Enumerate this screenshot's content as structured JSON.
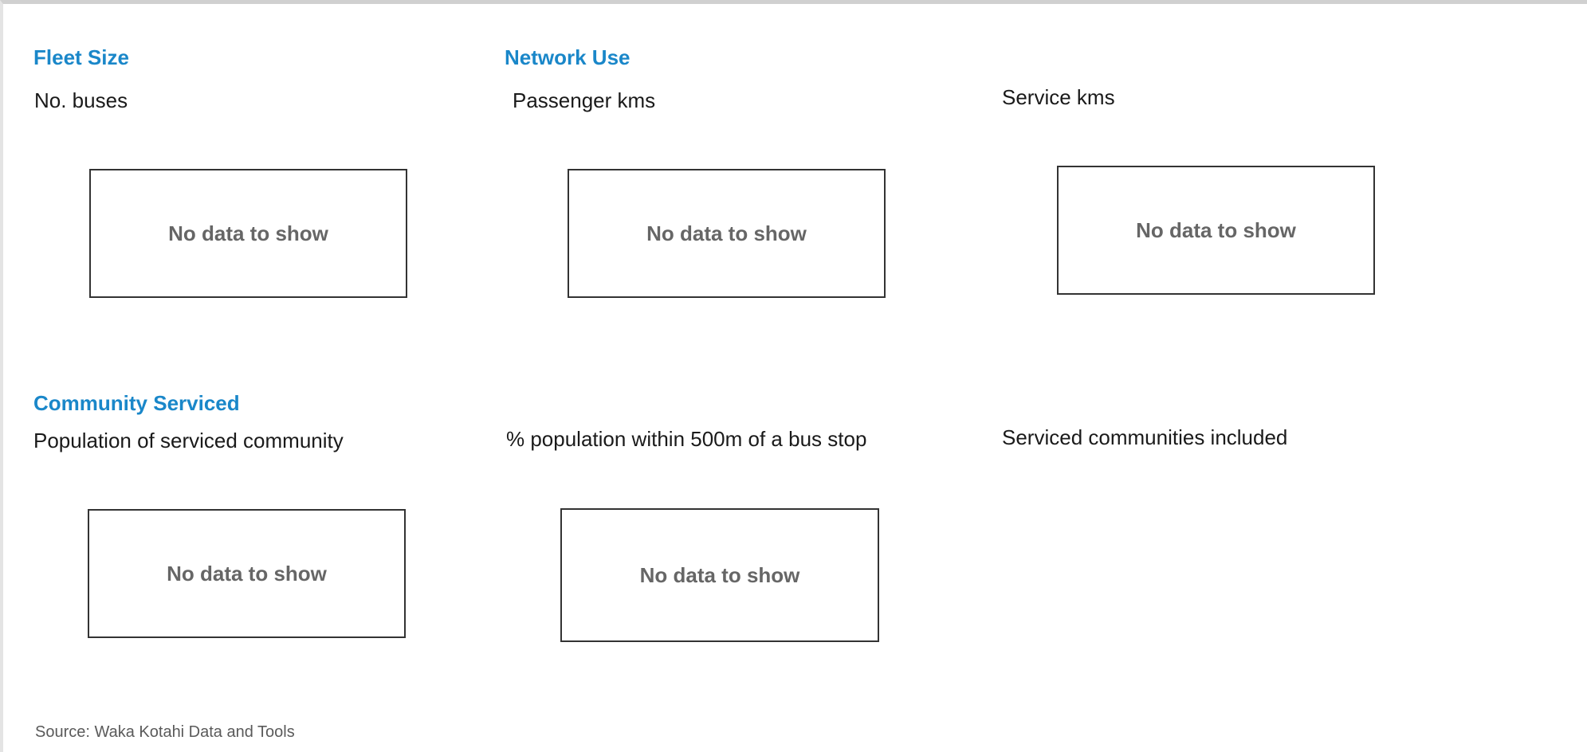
{
  "sections": {
    "fleet_size": {
      "heading": "Fleet Size",
      "metric_label": "No. buses",
      "empty_message": "No data to show"
    },
    "network_use": {
      "heading": "Network Use",
      "passenger_kms_label": "Passenger kms",
      "passenger_kms_empty": "No data to show",
      "service_kms_label": "Service kms",
      "service_kms_empty": "No data to show"
    },
    "community_serviced": {
      "heading": "Community Serviced",
      "population_label": "Population of serviced community",
      "population_empty": "No data to show",
      "pct_population_label": "% population within 500m of a bus stop",
      "pct_population_empty": "No data to show",
      "communities_included_label": "Serviced communities included"
    }
  },
  "footer": {
    "source": "Source: Waka Kotahi Data and Tools"
  },
  "colors": {
    "heading": "#1a87c9",
    "empty_text": "#666666",
    "border": "#333333"
  }
}
